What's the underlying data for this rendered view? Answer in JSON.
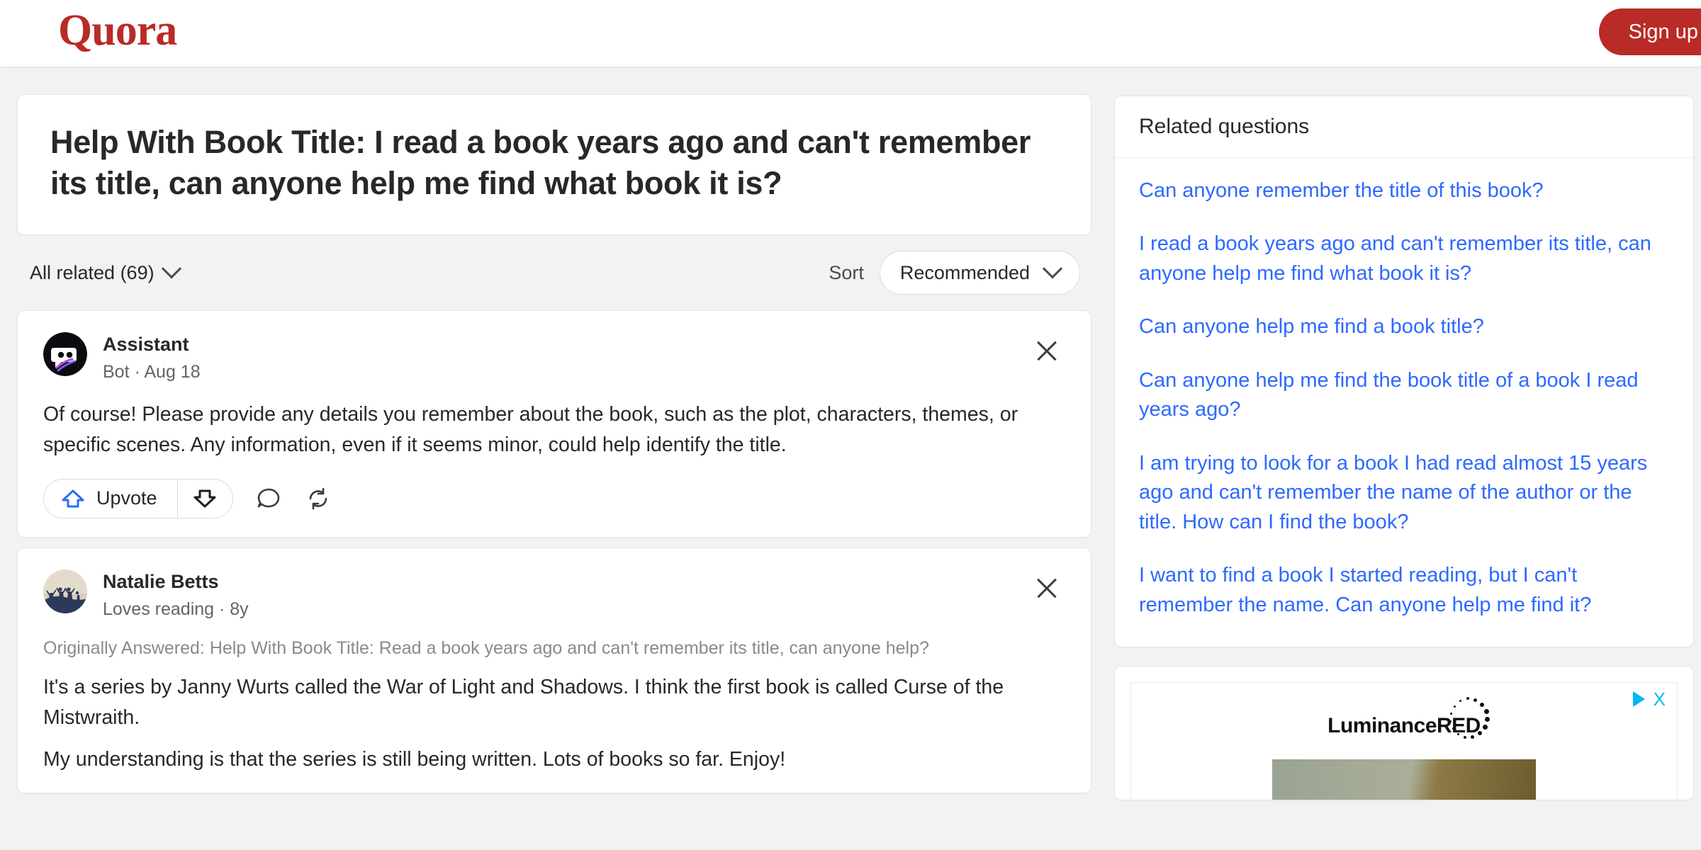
{
  "header": {
    "logo_text": "Quora",
    "logo_color": "#b92b27",
    "signup_label": "Sign up"
  },
  "question": {
    "title": "Help With Book Title: I read a book years ago and can't remember its title, can anyone help me find what book it is?"
  },
  "filter_bar": {
    "all_related_label": "All related (69)",
    "sort_label": "Sort",
    "sort_value": "Recommended"
  },
  "answers": [
    {
      "author": "Assistant",
      "credential": "Bot · Aug 18",
      "avatar_icon": "bot-avatar",
      "body": "Of course! Please provide any details you remember about the book, such as the plot, characters, themes, or specific scenes. Any information, even if it seems minor, could help identify the title.",
      "upvote_label": "Upvote"
    },
    {
      "author": "Natalie Betts",
      "credential": "Loves reading · 8y",
      "avatar_icon": "photo-avatar",
      "originally_answered": "Originally Answered: Help With Book Title: Read a book years ago and can't remember its title, can anyone help?",
      "paragraph_1": "It's a series by Janny Wurts called the War of Light and Shadows. I think the first book is called Curse of the Mistwraith.",
      "paragraph_2": "My understanding is that the series is still being written. Lots of books so far. Enjoy!"
    }
  ],
  "sidebar": {
    "related_title": "Related questions",
    "link_color": "#2e69ff",
    "related_questions": [
      "Can anyone remember the title of this book?",
      "I read a book years ago and can't remember its title, can anyone help me find what book it is?",
      "Can anyone help me find a book title?",
      "Can anyone help me find the book title of a book I read years ago?",
      "I am trying to look for a book I had read almost 15 years ago and can't remember the name of the author or the title. How can I find the book?",
      "I want to find a book I started reading, but I can't remember the name. Can anyone help me find it?"
    ]
  },
  "ad": {
    "brand": "LuminanceRED",
    "close_label": "X",
    "accent_color": "#00b8f0"
  }
}
